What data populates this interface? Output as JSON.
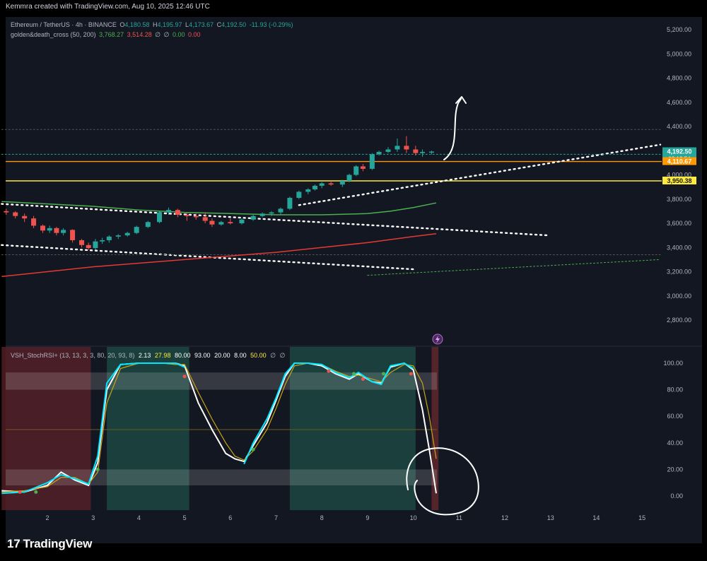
{
  "header": {
    "caption": "Kemmra created with TradingView.com, Aug 10, 2025 12:46 UTC"
  },
  "price_legend": {
    "symbol": "Ethereum / TetherUS · 4h · BINANCE",
    "o_label": "O",
    "o_value": "4,180.58",
    "h_label": "H",
    "h_value": "4,195.97",
    "l_label": "L",
    "l_value": "4,173.67",
    "c_label": "C",
    "c_value": "4,192.50",
    "change": "-11.93 (-0.29%)",
    "indicator": "golden&death_cross (50, 200)",
    "ind_v1": "3,768.27",
    "ind_v2": "3,514.28",
    "ind_v3": "∅",
    "ind_v4": "∅",
    "ind_v5": "0.00",
    "ind_v6": "0.00"
  },
  "osc_legend": {
    "name": "VSH_StochRSI+ (13, 13, 3, 3, 80, 20, 93, 8)",
    "v1": "2.13",
    "v2": "27.98",
    "v3": "80.00",
    "v4": "93.00",
    "v5": "20.00",
    "v6": "8.00",
    "v7": "50.00",
    "v8": "∅",
    "v9": "∅"
  },
  "branding": {
    "logo_mark": "17",
    "logo_text": "TradingView"
  },
  "colors": {
    "background": "#131722",
    "up": "#26a69a",
    "down": "#ef5350",
    "green_ma": "#4caf50",
    "red_ma": "#e53935",
    "orange_line": "#ff9800",
    "yellow_line": "#ffeb3b",
    "k_line": "#ffffff",
    "d_line": "#00e5ff",
    "signal": "#c8a415"
  },
  "chart_data": [
    {
      "type": "candlestick",
      "title": "Ethereum / TetherUS · 4h · BINANCE",
      "x_ticks": [
        "2",
        "3",
        "4",
        "5",
        "6",
        "7",
        "8",
        "9",
        "10",
        "11",
        "12",
        "13",
        "14",
        "15"
      ],
      "y_ticks": [
        "5,200.00",
        "5,000.00",
        "4,800.00",
        "4,600.00",
        "4,400.00",
        "4,200.00",
        "4,000.00",
        "3,800.00",
        "3,600.00",
        "3,400.00",
        "3,200.00",
        "3,000.00",
        "2,800.00"
      ],
      "ylim": [
        2700,
        5300
      ],
      "price_tags": [
        {
          "value": 4192.5,
          "label": "4,192.50",
          "sub": "03:13:54",
          "color": "#26a69a"
        },
        {
          "value": 4110.67,
          "label": "4,110.67",
          "color": "#ff9800"
        },
        {
          "value": 3950.38,
          "label": "3,950.38",
          "color": "#ffeb3b"
        }
      ],
      "horizontal_lines": [
        {
          "value": 4110.67,
          "color": "#ff9800"
        },
        {
          "value": 3950.38,
          "color": "#ffeb3b"
        }
      ],
      "candles": [
        [
          1.1,
          3700,
          3720,
          3670,
          3690
        ],
        [
          1.3,
          3690,
          3700,
          3640,
          3660
        ],
        [
          1.5,
          3660,
          3680,
          3610,
          3640
        ],
        [
          1.7,
          3640,
          3660,
          3560,
          3580
        ],
        [
          1.9,
          3580,
          3590,
          3520,
          3540
        ],
        [
          2.05,
          3540,
          3580,
          3520,
          3560
        ],
        [
          2.2,
          3560,
          3570,
          3500,
          3520
        ],
        [
          2.35,
          3520,
          3560,
          3500,
          3545
        ],
        [
          2.55,
          3545,
          3550,
          3440,
          3460
        ],
        [
          2.75,
          3460,
          3470,
          3400,
          3420
        ],
        [
          2.9,
          3420,
          3440,
          3380,
          3395
        ],
        [
          3.05,
          3395,
          3470,
          3380,
          3450
        ],
        [
          3.2,
          3450,
          3480,
          3430,
          3460
        ],
        [
          3.35,
          3460,
          3500,
          3440,
          3490
        ],
        [
          3.55,
          3490,
          3510,
          3470,
          3500
        ],
        [
          3.75,
          3500,
          3530,
          3490,
          3520
        ],
        [
          3.95,
          3520,
          3580,
          3510,
          3570
        ],
        [
          4.2,
          3570,
          3620,
          3560,
          3610
        ],
        [
          4.45,
          3610,
          3700,
          3600,
          3690
        ],
        [
          4.65,
          3690,
          3730,
          3670,
          3710
        ],
        [
          4.85,
          3710,
          3720,
          3650,
          3670
        ],
        [
          5.05,
          3670,
          3690,
          3620,
          3660
        ],
        [
          5.25,
          3660,
          3680,
          3630,
          3650
        ],
        [
          5.45,
          3650,
          3690,
          3600,
          3620
        ],
        [
          5.6,
          3620,
          3640,
          3570,
          3590
        ],
        [
          5.8,
          3590,
          3620,
          3580,
          3610
        ],
        [
          6.0,
          3610,
          3640,
          3590,
          3600
        ],
        [
          6.25,
          3600,
          3640,
          3590,
          3630
        ],
        [
          6.5,
          3630,
          3670,
          3620,
          3660
        ],
        [
          6.7,
          3660,
          3690,
          3650,
          3680
        ],
        [
          6.9,
          3680,
          3700,
          3660,
          3690
        ],
        [
          7.1,
          3690,
          3730,
          3670,
          3720
        ],
        [
          7.3,
          3720,
          3820,
          3710,
          3810
        ],
        [
          7.5,
          3810,
          3870,
          3800,
          3860
        ],
        [
          7.7,
          3860,
          3890,
          3840,
          3880
        ],
        [
          7.85,
          3880,
          3920,
          3870,
          3910
        ],
        [
          8.0,
          3910,
          3940,
          3890,
          3930
        ],
        [
          8.2,
          3930,
          3950,
          3910,
          3920
        ],
        [
          8.45,
          3920,
          3960,
          3900,
          3950
        ],
        [
          8.6,
          3950,
          4010,
          3940,
          4000
        ],
        [
          8.75,
          4000,
          4080,
          3990,
          4070
        ],
        [
          8.9,
          4070,
          4090,
          4030,
          4050
        ],
        [
          9.1,
          4050,
          4180,
          4040,
          4170
        ],
        [
          9.25,
          4170,
          4200,
          4160,
          4190
        ],
        [
          9.45,
          4190,
          4230,
          4180,
          4210
        ],
        [
          9.65,
          4210,
          4300,
          4190,
          4240
        ],
        [
          9.85,
          4240,
          4320,
          4180,
          4210
        ],
        [
          10.05,
          4210,
          4240,
          4160,
          4180
        ],
        [
          10.2,
          4180,
          4210,
          4150,
          4190
        ],
        [
          10.4,
          4190,
          4200,
          4170,
          4192.5
        ]
      ],
      "ma_green": [
        [
          1,
          3780
        ],
        [
          2,
          3760
        ],
        [
          3,
          3740
        ],
        [
          4,
          3710
        ],
        [
          5,
          3690
        ],
        [
          6,
          3680
        ],
        [
          7,
          3670
        ],
        [
          8,
          3670
        ],
        [
          9,
          3680
        ],
        [
          9.5,
          3700
        ],
        [
          10,
          3730
        ],
        [
          10.5,
          3768.27
        ]
      ],
      "ma_red": [
        [
          1,
          3160
        ],
        [
          2,
          3200
        ],
        [
          3,
          3240
        ],
        [
          4,
          3270
        ],
        [
          5,
          3300
        ],
        [
          6,
          3330
        ],
        [
          7,
          3360
        ],
        [
          8,
          3400
        ],
        [
          9,
          3440
        ],
        [
          10,
          3490
        ],
        [
          10.5,
          3514.28
        ]
      ],
      "trendlines_dotted": [
        {
          "from": [
            1,
            3760
          ],
          "to": [
            12.95,
            3500
          ],
          "color": "#ffffff"
        },
        {
          "from": [
            1,
            3420
          ],
          "to": [
            10.0,
            3220
          ],
          "color": "#ffffff"
        },
        {
          "from": [
            7.5,
            3750
          ],
          "to": [
            15.4,
            4250
          ],
          "color": "#ffffff"
        },
        {
          "from": [
            1,
            4170
          ],
          "to": [
            15.4,
            4170
          ],
          "color": "#26a69a"
        },
        {
          "from": [
            1,
            3340
          ],
          "to": [
            15.4,
            3340
          ],
          "color": "#555555"
        },
        {
          "from": [
            1,
            4375
          ],
          "to": [
            15.4,
            4375
          ],
          "color": "#555555"
        },
        {
          "from": [
            9.0,
            3170
          ],
          "to": [
            15.4,
            3300
          ],
          "color": "#4caf50"
        }
      ]
    },
    {
      "type": "line",
      "title": "VSH_StochRSI+ (13, 13, 3, 3, 80, 20, 93, 8)",
      "y_ticks": [
        "100.00",
        "80.00",
        "60.00",
        "40.00",
        "20.00",
        "0.00"
      ],
      "ylim": [
        -10,
        110
      ],
      "bands": [
        [
          8,
          20
        ],
        [
          80,
          93
        ]
      ],
      "series": [
        {
          "values": [
            [
              1,
              4
            ],
            [
              1.5,
              3
            ],
            [
              2,
              8
            ],
            [
              2.3,
              18
            ],
            [
              2.6,
              12
            ],
            [
              2.9,
              8
            ],
            [
              3.1,
              25
            ],
            [
              3.3,
              80
            ],
            [
              3.6,
              99
            ],
            [
              4,
              100
            ],
            [
              4.5,
              100
            ],
            [
              4.8,
              100
            ],
            [
              5,
              98
            ],
            [
              5.3,
              70
            ],
            [
              5.6,
              50
            ],
            [
              5.9,
              32
            ],
            [
              6.1,
              28
            ],
            [
              6.3,
              26
            ],
            [
              6.5,
              38
            ],
            [
              6.8,
              55
            ],
            [
              7.0,
              72
            ],
            [
              7.2,
              90
            ],
            [
              7.4,
              100
            ],
            [
              7.7,
              100
            ],
            [
              8.0,
              98
            ],
            [
              8.3,
              92
            ],
            [
              8.6,
              88
            ],
            [
              8.8,
              92
            ],
            [
              9.1,
              86
            ],
            [
              9.3,
              85
            ],
            [
              9.5,
              97
            ],
            [
              9.8,
              100
            ],
            [
              10.0,
              95
            ],
            [
              10.2,
              65
            ],
            [
              10.35,
              35
            ],
            [
              10.5,
              2
            ]
          ],
          "color": "#ffffff"
        },
        {
          "values": [
            [
              1,
              3
            ],
            [
              1.5,
              4
            ],
            [
              2,
              7
            ],
            [
              2.3,
              14
            ],
            [
              2.6,
              14
            ],
            [
              2.9,
              9
            ],
            [
              3.1,
              18
            ],
            [
              3.3,
              70
            ],
            [
              3.6,
              96
            ],
            [
              4,
              100
            ],
            [
              4.5,
              100
            ],
            [
              4.8,
              99
            ],
            [
              5,
              99
            ],
            [
              5.3,
              78
            ],
            [
              5.6,
              58
            ],
            [
              5.9,
              40
            ],
            [
              6.1,
              30
            ],
            [
              6.3,
              27
            ],
            [
              6.5,
              34
            ],
            [
              6.8,
              50
            ],
            [
              7.0,
              66
            ],
            [
              7.2,
              84
            ],
            [
              7.4,
              98
            ],
            [
              7.7,
              100
            ],
            [
              8.0,
              99
            ],
            [
              8.3,
              94
            ],
            [
              8.6,
              90
            ],
            [
              8.8,
              91
            ],
            [
              9.1,
              88
            ],
            [
              9.3,
              86
            ],
            [
              9.5,
              93
            ],
            [
              9.8,
              99
            ],
            [
              10.0,
              98
            ],
            [
              10.2,
              85
            ],
            [
              10.35,
              60
            ],
            [
              10.5,
              28
            ]
          ],
          "color": "#c8a415"
        },
        {
          "values": [
            [
              1,
              2
            ],
            [
              1.5,
              3
            ],
            [
              2,
              10
            ],
            [
              2.3,
              16
            ],
            [
              2.6,
              13
            ],
            [
              2.9,
              9
            ],
            [
              3.1,
              30
            ],
            [
              3.3,
              85
            ],
            [
              3.6,
              99
            ],
            [
              4,
              100
            ],
            [
              4.5,
              100
            ],
            [
              4.8,
              100
            ],
            [
              5,
              97
            ]
          ],
          "color": "#00e5ff"
        },
        {
          "values": [
            [
              6.3,
              24
            ],
            [
              6.5,
              40
            ],
            [
              6.8,
              58
            ],
            [
              7.0,
              74
            ],
            [
              7.2,
              92
            ],
            [
              7.4,
              100
            ],
            [
              7.7,
              100
            ],
            [
              8.0,
              99
            ],
            [
              8.3,
              93
            ],
            [
              8.6,
              89
            ],
            [
              8.8,
              93
            ],
            [
              9.1,
              86
            ],
            [
              9.3,
              84
            ],
            [
              9.5,
              98
            ],
            [
              9.8,
              100
            ],
            [
              10.0,
              96
            ]
          ],
          "color": "#00e5ff"
        }
      ],
      "zones": [
        {
          "from": 1.0,
          "to": 2.95,
          "color": "#5c2228"
        },
        {
          "from": 3.3,
          "to": 5.1,
          "color": "#1f4d47"
        },
        {
          "from": 7.3,
          "to": 10.05,
          "color": "#1f4d47"
        },
        {
          "from": 10.4,
          "to": 10.55,
          "color": "#6a2a2e"
        }
      ]
    }
  ]
}
